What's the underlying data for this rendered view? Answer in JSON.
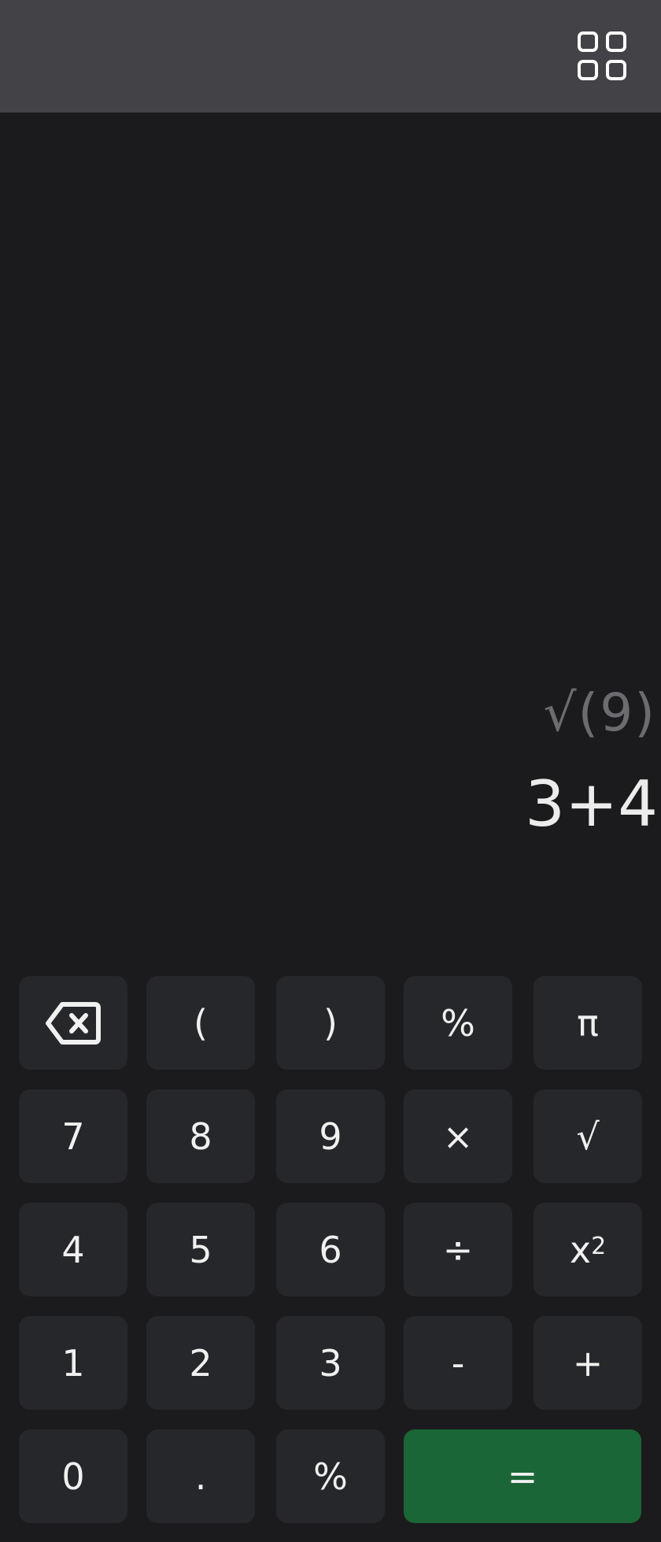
{
  "display": {
    "expression": "√(9)",
    "result": "3+4"
  },
  "toolbar": {
    "menu_icon": "grid-icon"
  },
  "keys": {
    "backspace_icon": "backspace-icon",
    "open_paren": "(",
    "close_paren": ")",
    "percent_top": "%",
    "pi": "π",
    "seven": "7",
    "eight": "8",
    "nine": "9",
    "multiply": "×",
    "sqrt": "√",
    "four": "4",
    "five": "5",
    "six": "6",
    "divide": "÷",
    "square_base": "x",
    "square_exp": "2",
    "one": "1",
    "two": "2",
    "three": "3",
    "minus": "-",
    "plus": "+",
    "zero": "0",
    "dot": ".",
    "percent_bottom": "%",
    "equals": "="
  },
  "colors": {
    "background": "#1b1b1d",
    "topbar": "#424247",
    "key": "#26272a",
    "equals_key": "#1a6636"
  }
}
